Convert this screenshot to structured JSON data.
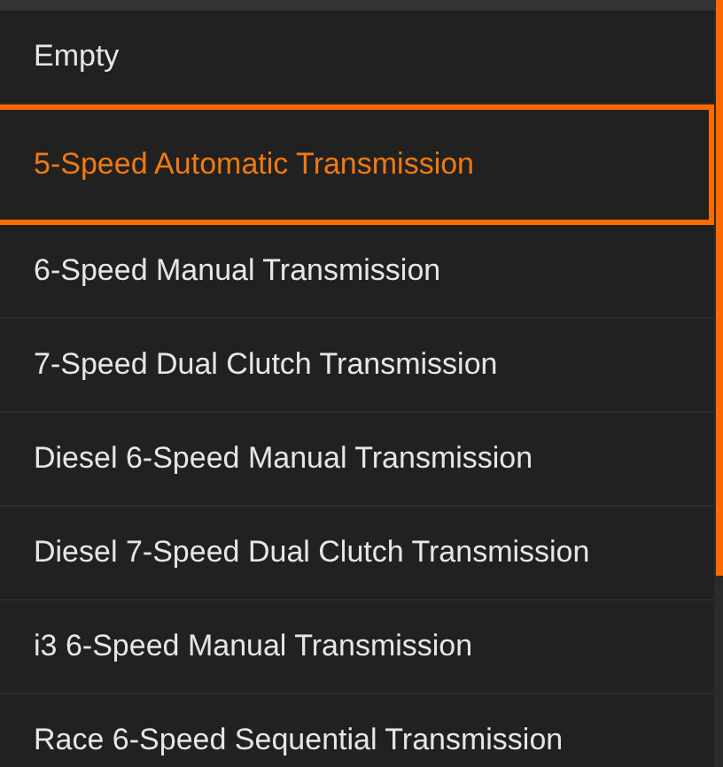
{
  "options": [
    {
      "label": "Empty",
      "selected": false
    },
    {
      "label": "5-Speed Automatic Transmission",
      "selected": true
    },
    {
      "label": "6-Speed Manual Transmission",
      "selected": false
    },
    {
      "label": "7-Speed Dual Clutch Transmission",
      "selected": false
    },
    {
      "label": "Diesel 6-Speed Manual Transmission",
      "selected": false
    },
    {
      "label": "Diesel 7-Speed Dual Clutch Transmission",
      "selected": false
    },
    {
      "label": "i3 6-Speed Manual Transmission",
      "selected": false
    },
    {
      "label": "Race 6-Speed Sequential Transmission",
      "selected": false
    }
  ]
}
